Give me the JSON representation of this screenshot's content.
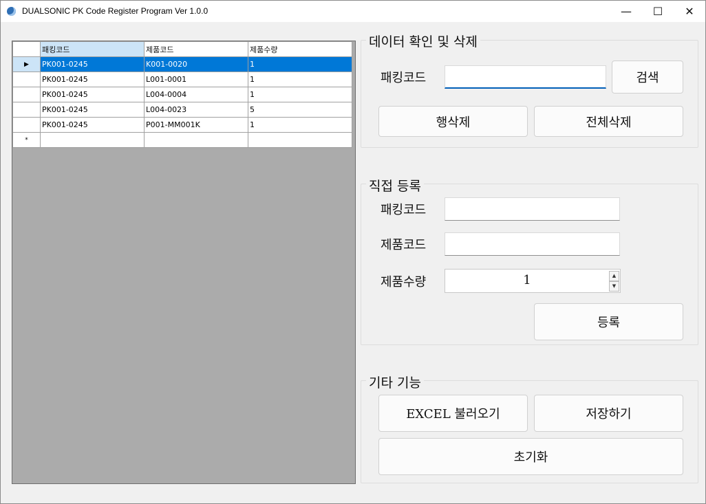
{
  "window": {
    "title": "DUALSONIC PK Code Register Program Ver 1.0.0",
    "controls": {
      "minimize": "—",
      "maximize": "☐",
      "close": "✕"
    }
  },
  "grid": {
    "columns": [
      "패킹코드",
      "제품코드",
      "제품수량"
    ],
    "rows": [
      [
        "PK001-0245",
        "K001-0020",
        "1"
      ],
      [
        "PK001-0245",
        "L001-0001",
        "1"
      ],
      [
        "PK001-0245",
        "L004-0004",
        "1"
      ],
      [
        "PK001-0245",
        "L004-0023",
        "5"
      ],
      [
        "PK001-0245",
        "P001-MM001K",
        "1"
      ]
    ],
    "current_row_marker": "▶",
    "new_row_marker": "*"
  },
  "check_delete": {
    "title": "데이터 확인 및 삭제",
    "packing_label": "패킹코드",
    "packing_value": "",
    "search_button": "검색",
    "delete_row_button": "행삭제",
    "delete_all_button": "전체삭제"
  },
  "direct_register": {
    "title": "직접 등록",
    "packing_label": "패킹코드",
    "packing_value": "",
    "product_label": "제품코드",
    "product_value": "",
    "qty_label": "제품수량",
    "qty_value": "1",
    "register_button": "등록"
  },
  "other": {
    "title": "기타 기능",
    "excel_button": "EXCEL 불러오기",
    "save_button": "저장하기",
    "reset_button": "초기화"
  },
  "colors": {
    "selection": "#0078d7",
    "focus_underline": "#005fb8",
    "grid_background": "#ababab"
  }
}
